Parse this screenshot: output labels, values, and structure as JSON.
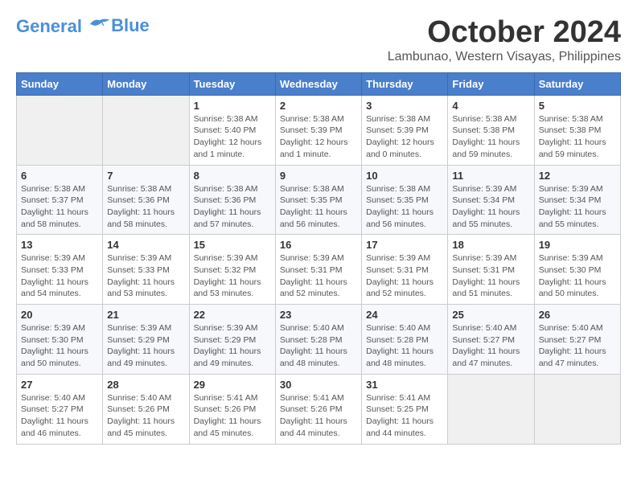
{
  "logo": {
    "line1": "General",
    "line2": "Blue"
  },
  "title": "October 2024",
  "location": "Lambunao, Western Visayas, Philippines",
  "weekdays": [
    "Sunday",
    "Monday",
    "Tuesday",
    "Wednesday",
    "Thursday",
    "Friday",
    "Saturday"
  ],
  "weeks": [
    [
      {
        "day": "",
        "info": ""
      },
      {
        "day": "",
        "info": ""
      },
      {
        "day": "1",
        "info": "Sunrise: 5:38 AM\nSunset: 5:40 PM\nDaylight: 12 hours and 1 minute."
      },
      {
        "day": "2",
        "info": "Sunrise: 5:38 AM\nSunset: 5:39 PM\nDaylight: 12 hours and 1 minute."
      },
      {
        "day": "3",
        "info": "Sunrise: 5:38 AM\nSunset: 5:39 PM\nDaylight: 12 hours and 0 minutes."
      },
      {
        "day": "4",
        "info": "Sunrise: 5:38 AM\nSunset: 5:38 PM\nDaylight: 11 hours and 59 minutes."
      },
      {
        "day": "5",
        "info": "Sunrise: 5:38 AM\nSunset: 5:38 PM\nDaylight: 11 hours and 59 minutes."
      }
    ],
    [
      {
        "day": "6",
        "info": "Sunrise: 5:38 AM\nSunset: 5:37 PM\nDaylight: 11 hours and 58 minutes."
      },
      {
        "day": "7",
        "info": "Sunrise: 5:38 AM\nSunset: 5:36 PM\nDaylight: 11 hours and 58 minutes."
      },
      {
        "day": "8",
        "info": "Sunrise: 5:38 AM\nSunset: 5:36 PM\nDaylight: 11 hours and 57 minutes."
      },
      {
        "day": "9",
        "info": "Sunrise: 5:38 AM\nSunset: 5:35 PM\nDaylight: 11 hours and 56 minutes."
      },
      {
        "day": "10",
        "info": "Sunrise: 5:38 AM\nSunset: 5:35 PM\nDaylight: 11 hours and 56 minutes."
      },
      {
        "day": "11",
        "info": "Sunrise: 5:39 AM\nSunset: 5:34 PM\nDaylight: 11 hours and 55 minutes."
      },
      {
        "day": "12",
        "info": "Sunrise: 5:39 AM\nSunset: 5:34 PM\nDaylight: 11 hours and 55 minutes."
      }
    ],
    [
      {
        "day": "13",
        "info": "Sunrise: 5:39 AM\nSunset: 5:33 PM\nDaylight: 11 hours and 54 minutes."
      },
      {
        "day": "14",
        "info": "Sunrise: 5:39 AM\nSunset: 5:33 PM\nDaylight: 11 hours and 53 minutes."
      },
      {
        "day": "15",
        "info": "Sunrise: 5:39 AM\nSunset: 5:32 PM\nDaylight: 11 hours and 53 minutes."
      },
      {
        "day": "16",
        "info": "Sunrise: 5:39 AM\nSunset: 5:31 PM\nDaylight: 11 hours and 52 minutes."
      },
      {
        "day": "17",
        "info": "Sunrise: 5:39 AM\nSunset: 5:31 PM\nDaylight: 11 hours and 52 minutes."
      },
      {
        "day": "18",
        "info": "Sunrise: 5:39 AM\nSunset: 5:31 PM\nDaylight: 11 hours and 51 minutes."
      },
      {
        "day": "19",
        "info": "Sunrise: 5:39 AM\nSunset: 5:30 PM\nDaylight: 11 hours and 50 minutes."
      }
    ],
    [
      {
        "day": "20",
        "info": "Sunrise: 5:39 AM\nSunset: 5:30 PM\nDaylight: 11 hours and 50 minutes."
      },
      {
        "day": "21",
        "info": "Sunrise: 5:39 AM\nSunset: 5:29 PM\nDaylight: 11 hours and 49 minutes."
      },
      {
        "day": "22",
        "info": "Sunrise: 5:39 AM\nSunset: 5:29 PM\nDaylight: 11 hours and 49 minutes."
      },
      {
        "day": "23",
        "info": "Sunrise: 5:40 AM\nSunset: 5:28 PM\nDaylight: 11 hours and 48 minutes."
      },
      {
        "day": "24",
        "info": "Sunrise: 5:40 AM\nSunset: 5:28 PM\nDaylight: 11 hours and 48 minutes."
      },
      {
        "day": "25",
        "info": "Sunrise: 5:40 AM\nSunset: 5:27 PM\nDaylight: 11 hours and 47 minutes."
      },
      {
        "day": "26",
        "info": "Sunrise: 5:40 AM\nSunset: 5:27 PM\nDaylight: 11 hours and 47 minutes."
      }
    ],
    [
      {
        "day": "27",
        "info": "Sunrise: 5:40 AM\nSunset: 5:27 PM\nDaylight: 11 hours and 46 minutes."
      },
      {
        "day": "28",
        "info": "Sunrise: 5:40 AM\nSunset: 5:26 PM\nDaylight: 11 hours and 45 minutes."
      },
      {
        "day": "29",
        "info": "Sunrise: 5:41 AM\nSunset: 5:26 PM\nDaylight: 11 hours and 45 minutes."
      },
      {
        "day": "30",
        "info": "Sunrise: 5:41 AM\nSunset: 5:26 PM\nDaylight: 11 hours and 44 minutes."
      },
      {
        "day": "31",
        "info": "Sunrise: 5:41 AM\nSunset: 5:25 PM\nDaylight: 11 hours and 44 minutes."
      },
      {
        "day": "",
        "info": ""
      },
      {
        "day": "",
        "info": ""
      }
    ]
  ]
}
